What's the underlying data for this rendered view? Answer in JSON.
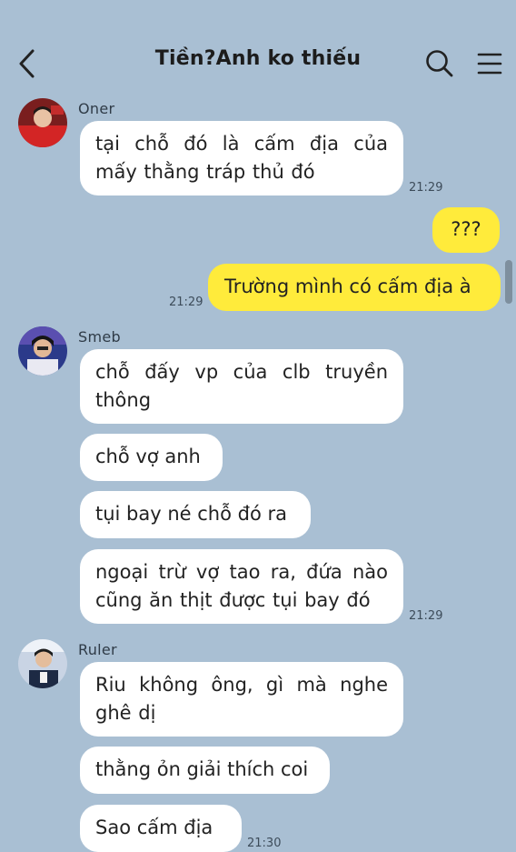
{
  "header": {
    "title": "Tiền?Anh ko thiếu"
  },
  "messages": {
    "oner_name": "Oner",
    "oner_msg": "tại chỗ đó là cấm địa của mấy thằng tráp thủ đó",
    "oner_time": "21:29",
    "me_msg1": "???",
    "me_msg2": "Trường mình có cấm địa à",
    "me_time": "21:29",
    "smeb_name": "Smeb",
    "smeb_msg1": "chỗ đấy vp của clb truyền thông",
    "smeb_msg2": "chỗ vợ anh",
    "smeb_msg3": "tụi bay né chỗ đó ra",
    "smeb_msg4": "ngoại trừ vợ tao ra, đứa nào cũng ăn thịt được tụi bay đó",
    "smeb_time": "21:29",
    "ruler_name": "Ruler",
    "ruler_msg1": "Riu không ông, gì mà nghe ghê dị",
    "ruler_msg2": "thằng ỏn giải thích coi",
    "ruler_msg3": "Sao cấm địa",
    "ruler_time": "21:30"
  },
  "colors": {
    "background": "#a9bfd3",
    "incoming_bubble": "#ffffff",
    "outgoing_bubble": "#ffeb3b"
  },
  "icons": {
    "back": "chevron-left-icon",
    "search": "search-icon",
    "menu": "hamburger-menu-icon"
  }
}
